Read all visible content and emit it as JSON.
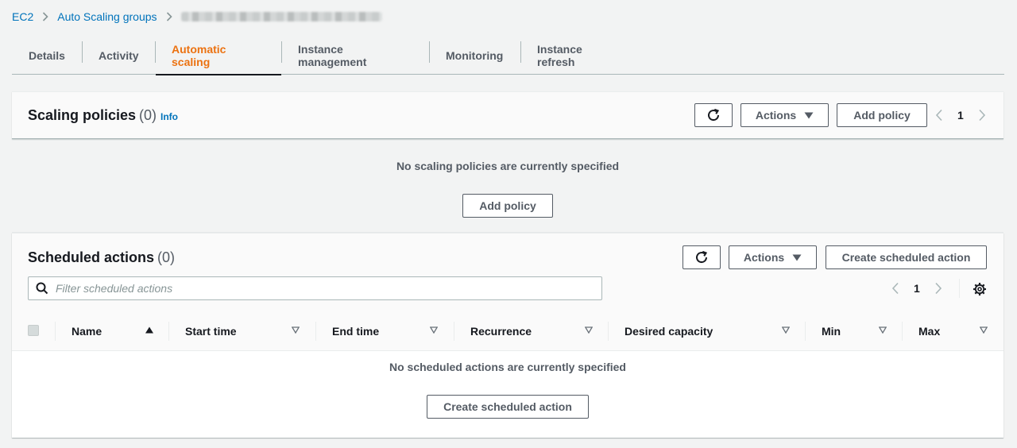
{
  "breadcrumb": {
    "items": [
      "EC2",
      "Auto Scaling groups"
    ]
  },
  "tabs": [
    "Details",
    "Activity",
    "Automatic scaling",
    "Instance management",
    "Monitoring",
    "Instance refresh"
  ],
  "active_tab": "Automatic scaling",
  "scaling_policies": {
    "title": "Scaling policies",
    "count": "(0)",
    "info_label": "Info",
    "actions_label": "Actions",
    "add_policy_label": "Add policy",
    "page": "1",
    "empty_text": "No scaling policies are currently specified",
    "empty_button": "Add policy"
  },
  "scheduled_actions": {
    "title": "Scheduled actions",
    "count": "(0)",
    "actions_label": "Actions",
    "create_label": "Create scheduled action",
    "filter_placeholder": "Filter scheduled actions",
    "page": "1",
    "columns": [
      "Name",
      "Start time",
      "End time",
      "Recurrence",
      "Desired capacity",
      "Min",
      "Max"
    ],
    "empty_text": "No scheduled actions are currently specified",
    "empty_button": "Create scheduled action"
  },
  "colors": {
    "link": "#0073bb",
    "active_tab": "#ec7211",
    "text": "#16191f",
    "secondary_text": "#545b64",
    "background": "#f2f3f3"
  },
  "icons": [
    "chevron-right-icon",
    "refresh-icon",
    "caret-down-icon",
    "chevron-left-icon",
    "search-icon",
    "gear-icon",
    "sort-asc-icon",
    "sort-icon"
  ]
}
